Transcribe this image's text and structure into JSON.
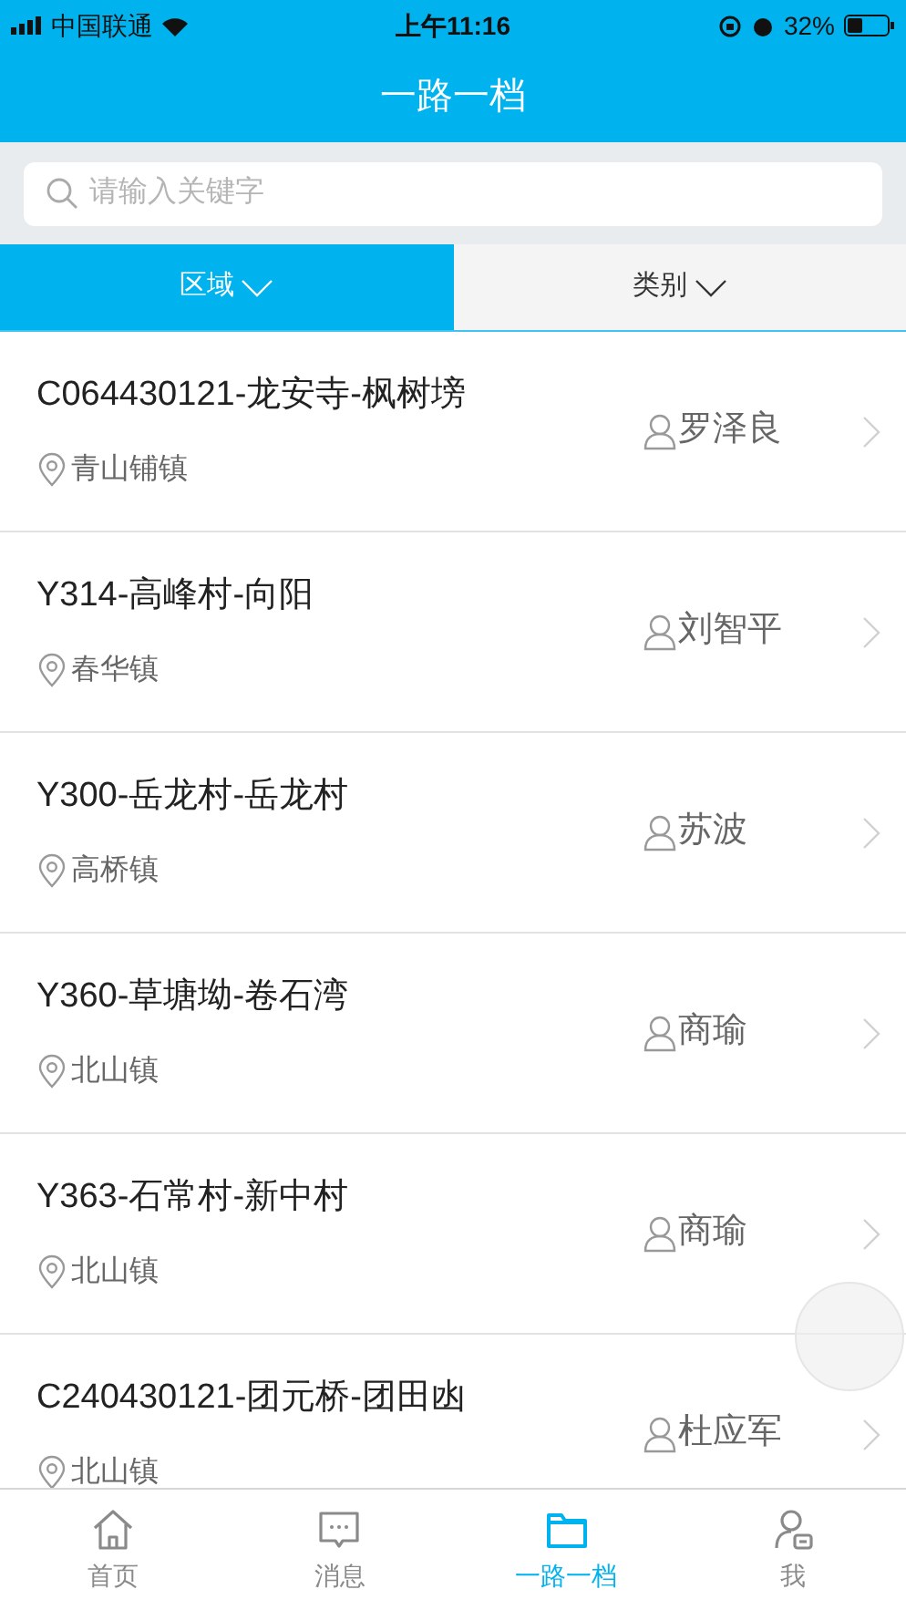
{
  "status_bar": {
    "carrier": "中国联通",
    "time": "上午11:16",
    "battery": "32%"
  },
  "nav": {
    "title": "一路一档"
  },
  "search": {
    "placeholder": "请输入关键字"
  },
  "filters": [
    {
      "label": "区域",
      "selected": true
    },
    {
      "label": "类别",
      "selected": false
    }
  ],
  "roads": [
    {
      "title": "C064430121-龙安寺-枫树塝",
      "location": "青山铺镇",
      "person": "罗泽良"
    },
    {
      "title": "Y314-高峰村-向阳",
      "location": "春华镇",
      "person": "刘智平"
    },
    {
      "title": "Y300-岳龙村-岳龙村",
      "location": "高桥镇",
      "person": "苏波"
    },
    {
      "title": "Y360-草塘坳-卷石湾",
      "location": "北山镇",
      "person": "商瑜"
    },
    {
      "title": "Y363-石常村-新中村",
      "location": "北山镇",
      "person": "商瑜"
    },
    {
      "title": "C240430121-团元桥-团田凼",
      "location": "北山镇",
      "person": "杜应军"
    }
  ],
  "tab_bar": [
    {
      "label": "首页",
      "kind": "home",
      "selected": false
    },
    {
      "label": "消息",
      "kind": "message",
      "selected": false
    },
    {
      "label": "一路一档",
      "kind": "folder",
      "selected": true
    },
    {
      "label": "我",
      "kind": "me",
      "selected": false
    }
  ]
}
